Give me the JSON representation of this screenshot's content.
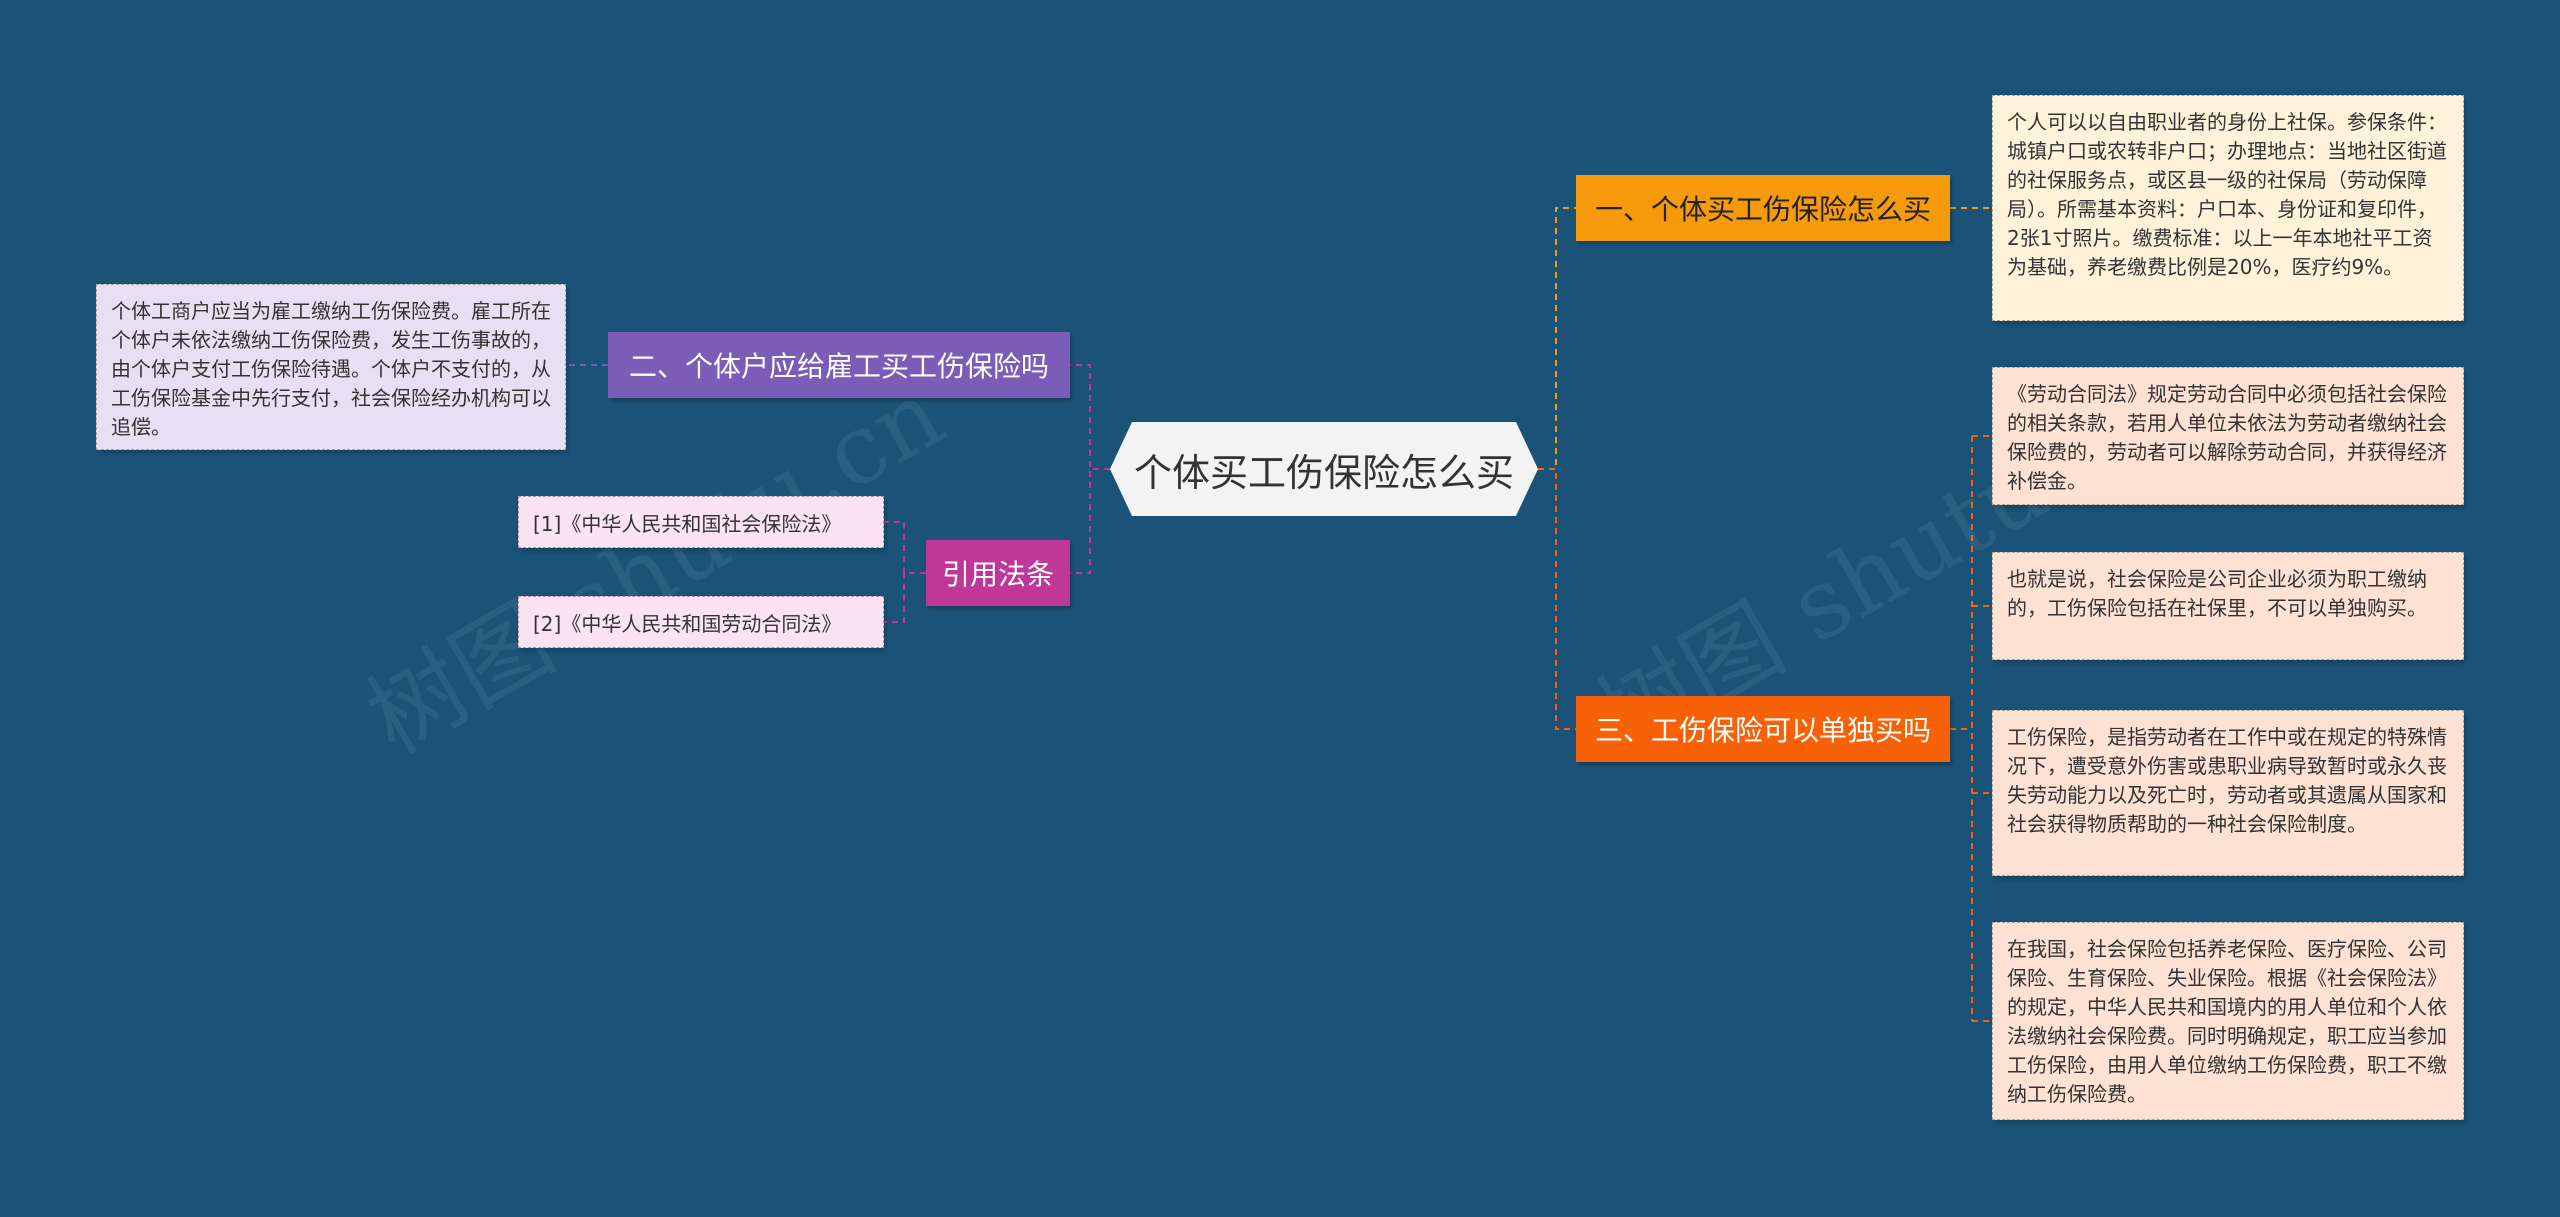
{
  "center": {
    "label": "个体买工伤保险怎么买"
  },
  "branches": {
    "b1": {
      "label": "一、个体买工伤保险怎么买",
      "color": "#f59a0b"
    },
    "b2": {
      "label": "二、个体户应给雇工买工伤保险吗",
      "color": "#7b5cb6"
    },
    "b3": {
      "label": "三、工伤保险可以单独买吗",
      "color": "#f76108"
    },
    "b4": {
      "label": "引用法条",
      "color": "#c0379a"
    }
  },
  "leaves": {
    "l1": "个人可以以自由职业者的身份上社保。参保条件：城镇户口或农转非户口；办理地点：当地社区街道的社保服务点，或区县一级的社保局（劳动保障局）。所需基本资料：户口本、身份证和复印件，2张1寸照片。缴费标准：以上一年本地社平工资为基础，养老缴费比例是20%，医疗约9%。",
    "l2": "个体工商户应当为雇工缴纳工伤保险费。雇工所在个体户未依法缴纳工伤保险费，发生工伤事故的，由个体户支付工伤保险待遇。个体户不支付的，从工伤保险基金中先行支付，社会保险经办机构可以追偿。",
    "l31": "《劳动合同法》规定劳动合同中必须包括社会保险的相关条款，若用人单位未依法为劳动者缴纳社会保险费的，劳动者可以解除劳动合同，并获得经济补偿金。",
    "l32": "也就是说，社会保险是公司企业必须为职工缴纳的，工伤保险包括在社保里，不可以单独购买。",
    "l33": "工伤保险，是指劳动者在工作中或在规定的特殊情况下，遭受意外伤害或患职业病导致暂时或永久丧失劳动能力以及死亡时，劳动者或其遗属从国家和社会获得物质帮助的一种社会保险制度。",
    "l34": "在我国，社会保险包括养老保险、医疗保险、公司保险、生育保险、失业保险。根据《社会保险法》的规定，中华人民共和国境内的用人单位和个人依法缴纳社会保险费。同时明确规定，职工应当参加工伤保险，由用人单位缴纳工伤保险费，职工不缴纳工伤保险费。"
  },
  "refs": {
    "r1": "[1]《中华人民共和国社会保险法》",
    "r2": "[2]《中华人民共和国劳动合同法》"
  },
  "watermark": [
    "树图 shutu.cn",
    "树图 shutu.cn"
  ],
  "colors": {
    "background": "#1b5378"
  }
}
